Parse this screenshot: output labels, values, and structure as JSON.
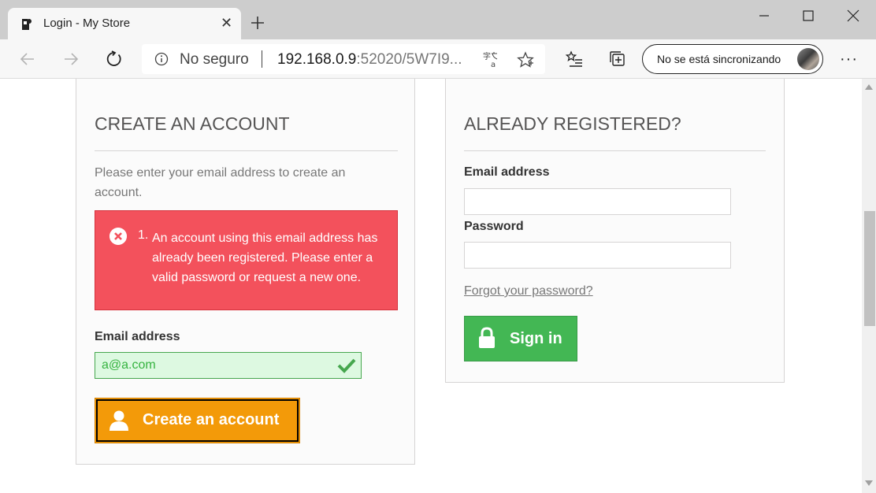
{
  "browser": {
    "tab_title": "Login - My Store",
    "tab_close": "✕",
    "address_insecure_label": "No seguro",
    "address_host": "192.168.0.9",
    "address_rest": ":52020/5W7I9...",
    "sync_label": "No se está sincronizando",
    "more_label": "···"
  },
  "create_account": {
    "heading": "CREATE AN ACCOUNT",
    "intro": "Please enter your email address to create an account.",
    "error_number": "1.",
    "error_message": "An account using this email address has already been registered. Please enter a valid password or request a new one.",
    "email_label": "Email address",
    "email_value": "a@a.com",
    "submit_label": "Create an account"
  },
  "login": {
    "heading": "ALREADY REGISTERED?",
    "email_label": "Email address",
    "email_value": "",
    "password_label": "Password",
    "password_value": "",
    "forgot_label": "Forgot your password?",
    "submit_label": "Sign in"
  },
  "colors": {
    "error_bg": "#f3515c",
    "create_button": "#f39a09",
    "signin_button": "#43b754",
    "valid_field_bg": "#ddf9e1"
  }
}
